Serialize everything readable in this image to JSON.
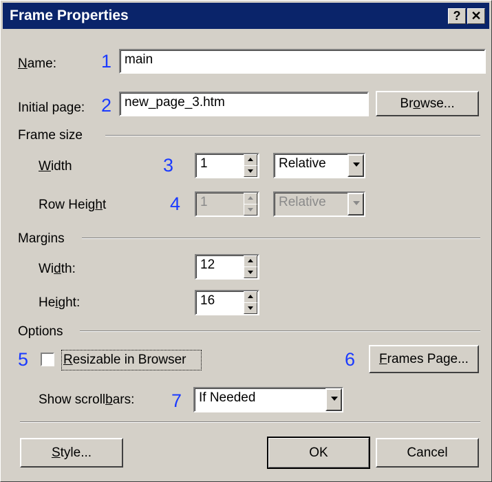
{
  "window": {
    "title": "Frame Properties",
    "help_label": "?",
    "close_label": "✕"
  },
  "annotations": [
    "1",
    "2",
    "3",
    "4",
    "5",
    "6",
    "7"
  ],
  "name": {
    "label_u": "N",
    "label_rest": "ame:",
    "value": "main"
  },
  "initial_page": {
    "label": "Initial page:",
    "value": "new_page_3.htm",
    "browse_pre": "Br",
    "browse_u": "o",
    "browse_post": "wse..."
  },
  "frame_size": {
    "section": "Frame size",
    "width_u": "W",
    "width_rest": "idth",
    "width_value": "1",
    "width_unit": "Relative",
    "row_pre": "Row Heig",
    "row_u": "h",
    "row_post": "t",
    "row_value": "1",
    "row_unit": "Relative"
  },
  "margins": {
    "section": "Margins",
    "width_pre": "Wi",
    "width_u": "d",
    "width_post": "th:",
    "width_value": "12",
    "height_pre": "He",
    "height_u": "i",
    "height_post": "ght:",
    "height_value": "16"
  },
  "options": {
    "section": "Options",
    "resizable_u": "R",
    "resizable_rest": "esizable in Browser",
    "resizable_checked": false,
    "frames_u": "F",
    "frames_rest": "rames Page...",
    "scroll_pre": "Show scroll",
    "scroll_u": "b",
    "scroll_post": "ars:",
    "scroll_value": "If Needed"
  },
  "footer": {
    "style_u": "S",
    "style_rest": "tyle...",
    "ok": "OK",
    "cancel": "Cancel"
  }
}
